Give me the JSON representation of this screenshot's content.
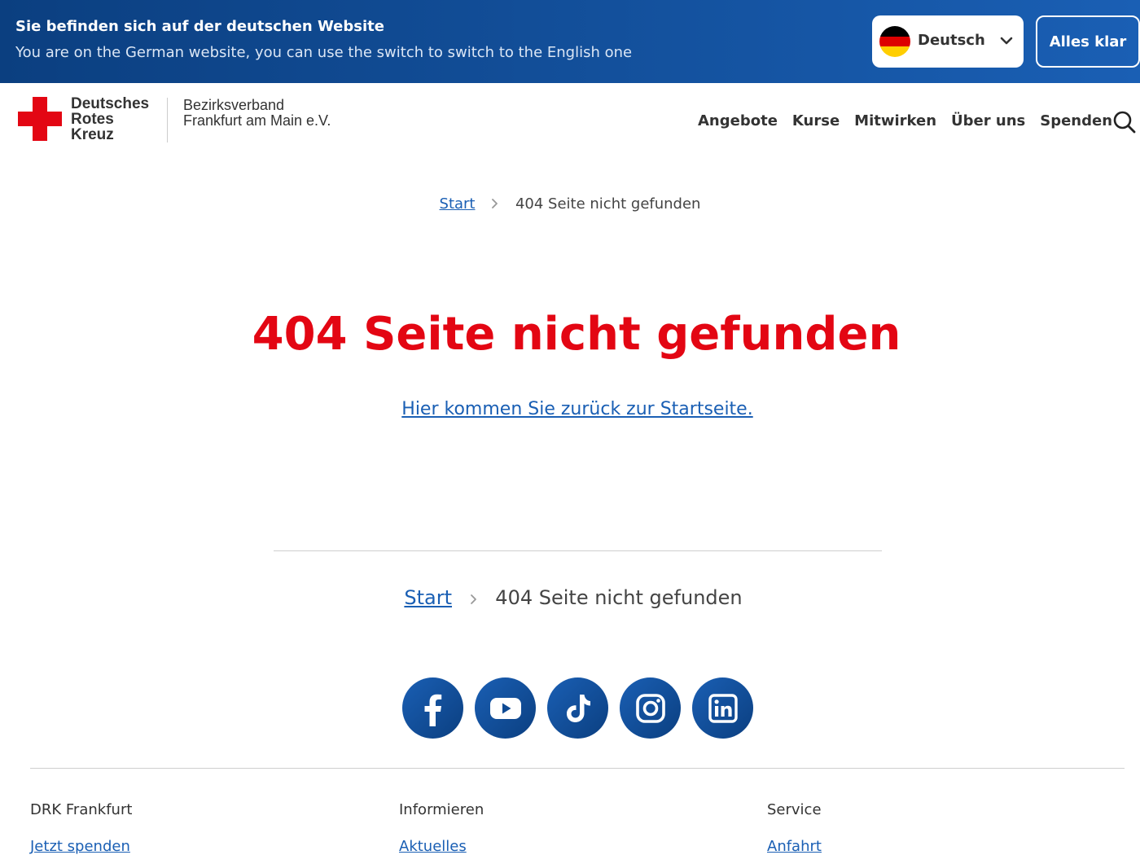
{
  "banner": {
    "title": "Sie befinden sich auf der deutschen Website",
    "subtitle": "You are on the German website, you can use the switch to switch to the English one",
    "language_select": {
      "selected": "Deutsch",
      "flag_icon": "german-flag-icon"
    },
    "confirm_label": "Alles klar",
    "colors": {
      "background_start": "#0b3f80",
      "background_end": "#1a5fb4"
    }
  },
  "header": {
    "logo": {
      "line1": "Deutsches",
      "line2": "Rotes",
      "line3": "Kreuz",
      "icon": "red-cross-icon",
      "color": "#e30613"
    },
    "org": {
      "line1": "Bezirksverband",
      "line2": "Frankfurt am Main e.V."
    },
    "nav": [
      "Angebote",
      "Kurse",
      "Mitwirken",
      "Über uns",
      "Spenden"
    ],
    "search_icon": "search-icon"
  },
  "breadcrumb": {
    "start": "Start",
    "current": "404 Seite nicht gefunden"
  },
  "main": {
    "title": "404 Seite nicht gefunden",
    "back_link": "Hier kommen Sie zurück zur Startseite.",
    "title_color": "#e30613",
    "link_color": "#1a5fb4"
  },
  "social": [
    "facebook-icon",
    "youtube-icon",
    "tiktok-icon",
    "instagram-icon",
    "linkedin-icon"
  ],
  "footer": {
    "columns": [
      {
        "heading": "DRK Frankfurt",
        "link": "Jetzt spenden"
      },
      {
        "heading": "Informieren",
        "link": "Aktuelles"
      },
      {
        "heading": "Service",
        "link": "Anfahrt"
      }
    ]
  }
}
